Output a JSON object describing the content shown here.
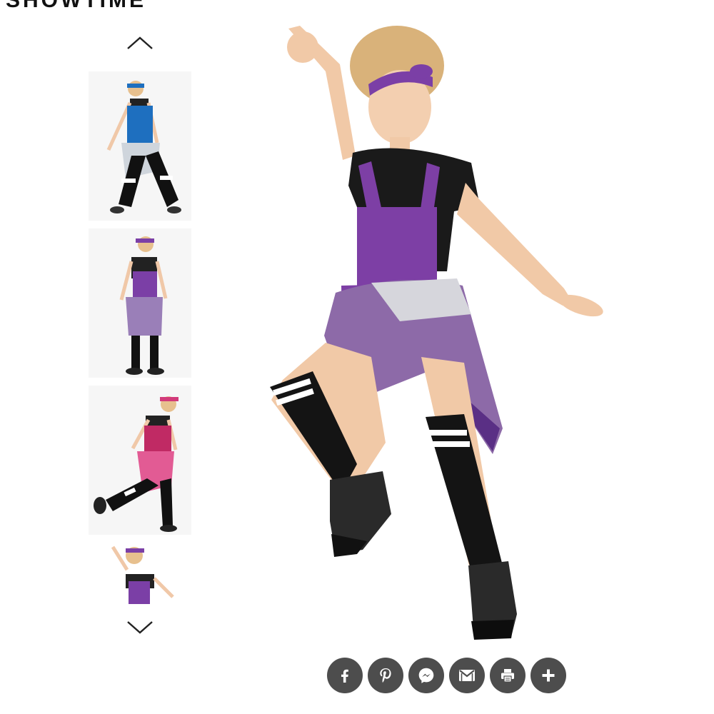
{
  "header": {
    "brand": "SHOWTIME"
  },
  "gallery": {
    "prev_icon": "chevron-up-icon",
    "next_icon": "chevron-down-icon",
    "thumbnails": [
      {
        "name": "thumbnail-blue-overalls",
        "accent": "#1e6fbf"
      },
      {
        "name": "thumbnail-purple-overalls-back",
        "accent": "#7b3fa6"
      },
      {
        "name": "thumbnail-pink-overalls",
        "accent": "#d23a7a"
      },
      {
        "name": "thumbnail-purple-overalls-partial",
        "accent": "#7b3fa6"
      }
    ],
    "main_image": {
      "costume_color": "#7d3fa5"
    }
  },
  "share": {
    "buttons": [
      {
        "icon": "facebook-icon"
      },
      {
        "icon": "pinterest-icon"
      },
      {
        "icon": "messenger-icon"
      },
      {
        "icon": "gmail-icon"
      },
      {
        "icon": "print-icon"
      },
      {
        "icon": "plus-icon"
      }
    ],
    "button_color": "#4d4d4d"
  }
}
